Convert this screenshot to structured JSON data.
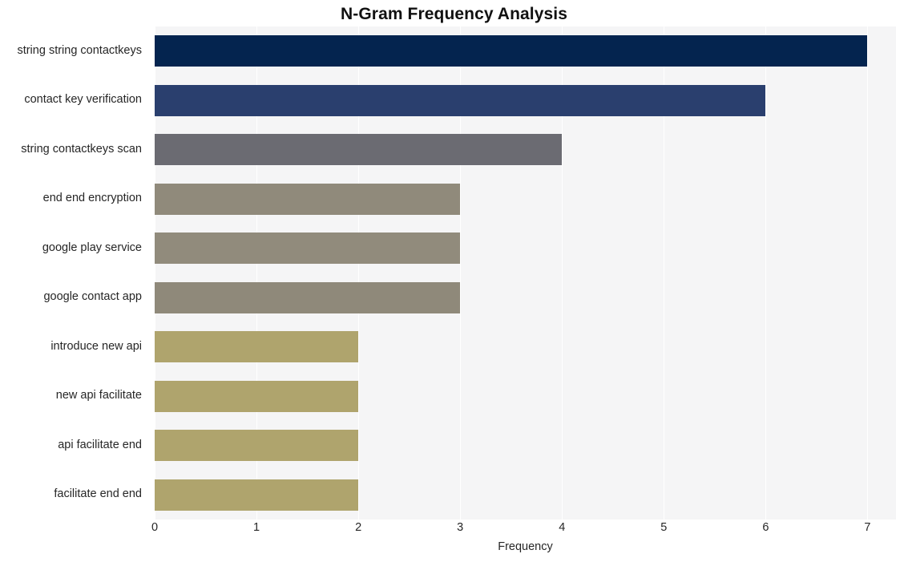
{
  "chart_data": {
    "type": "bar",
    "orientation": "horizontal",
    "title": "N-Gram Frequency Analysis",
    "xlabel": "Frequency",
    "ylabel": "",
    "categories": [
      "string string contactkeys",
      "contact key verification",
      "string contactkeys scan",
      "end end encryption",
      "google play service",
      "google contact app",
      "introduce new api",
      "new api facilitate",
      "api facilitate end",
      "facilitate end end"
    ],
    "values": [
      7,
      6,
      4,
      3,
      3,
      3,
      2,
      2,
      2,
      2
    ],
    "bar_colors": [
      "#04244f",
      "#2a3f6e",
      "#6b6b72",
      "#908a7b",
      "#918b7c",
      "#8f897a",
      "#afa46d",
      "#afa46d",
      "#afa46d",
      "#afa46d"
    ],
    "xlim": [
      0,
      7.28
    ],
    "xticks": [
      0,
      1,
      2,
      3,
      4,
      5,
      6,
      7
    ],
    "xtick_labels": [
      "0",
      "1",
      "2",
      "3",
      "4",
      "5",
      "6",
      "7"
    ],
    "grid": true,
    "grid_color": "#ffffff",
    "plot_background": "#f5f5f6",
    "figure_background": "#ffffff",
    "legend": null
  }
}
